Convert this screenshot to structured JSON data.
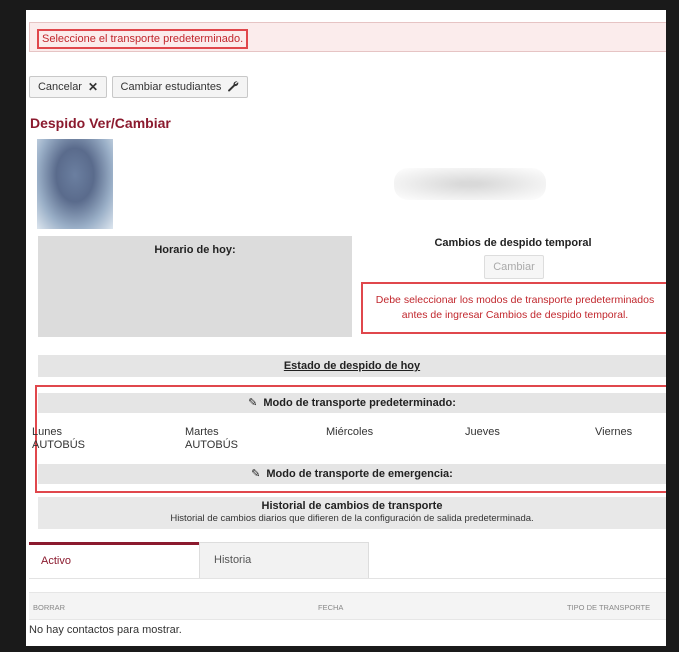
{
  "alert": {
    "text": "Seleccione el transporte predeterminado."
  },
  "toolbar": {
    "cancel_label": "Cancelar",
    "cancel_icon": "close-icon",
    "change_students_label": "Cambiar estudiantes",
    "change_students_icon": "wrench-icon"
  },
  "page_title": "Despido Ver/Cambiar",
  "schedule": {
    "title": "Horario de hoy:"
  },
  "temporary_changes": {
    "title": "Cambios de despido temporal",
    "change_button": "Cambiar",
    "warning_line1": "Debe seleccionar los modos de transporte predeterminados",
    "warning_line2": "antes de ingresar Cambios de despido temporal."
  },
  "today_status": {
    "title": "Estado de despido de hoy"
  },
  "default_mode": {
    "title": "Modo de transporte predeterminado:",
    "days": [
      {
        "day": "Lunes",
        "mode": "AUTOBÚS"
      },
      {
        "day": "Martes",
        "mode": "AUTOBÚS"
      },
      {
        "day": "Miércoles",
        "mode": ""
      },
      {
        "day": "Jueves",
        "mode": ""
      },
      {
        "day": "Viernes",
        "mode": ""
      }
    ]
  },
  "emergency_mode": {
    "title": "Modo de transporte de emergencia:"
  },
  "history": {
    "title": "Historial de cambios de transporte",
    "subtitle": "Historial de cambios diarios que difieren de la configuración de salida predeterminada."
  },
  "tabs": [
    {
      "label": "Activo"
    },
    {
      "label": "Historia"
    }
  ],
  "table": {
    "columns": [
      "BORRAR",
      "FECHA",
      "TIPO DE TRANSPORTE"
    ],
    "empty_text": "No hay contactos para mostrar."
  },
  "colors": {
    "accent": "#8b1a2e",
    "alert_red": "#c1272d",
    "annotation_red": "#e0474c"
  }
}
